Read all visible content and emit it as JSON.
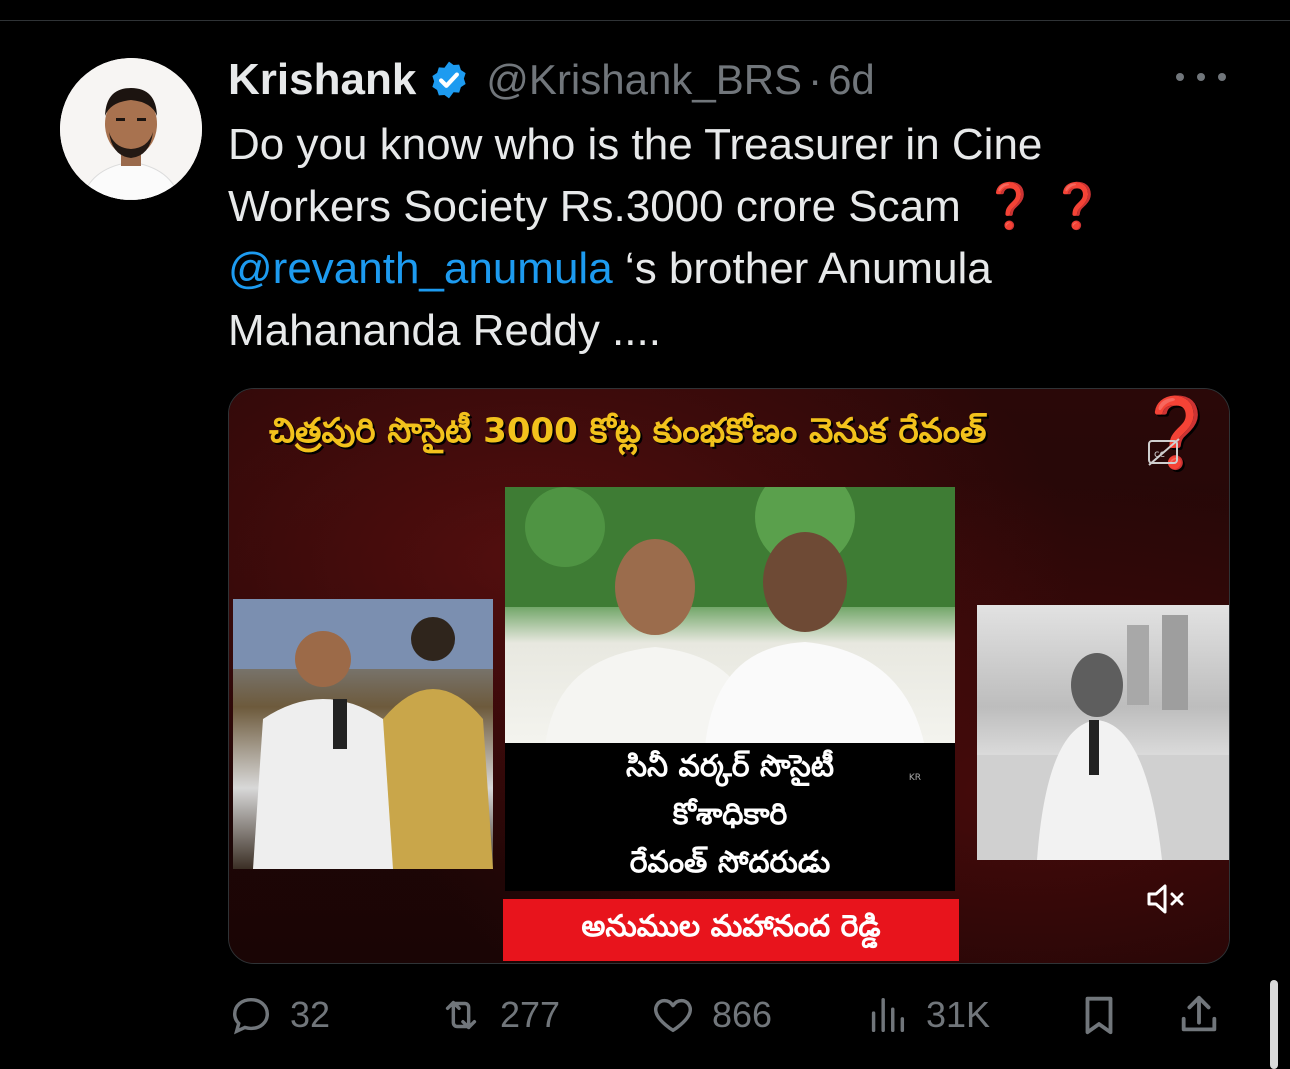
{
  "tweet": {
    "author_name": "Krishank",
    "handle": "@Krishank_BRS",
    "separator": "·",
    "time": "6d",
    "text_lines": [
      "Do you know who is the Treasurer in Cine",
      "Workers Society Rs.3000 crore Scam"
    ],
    "mention": "@revanth_anumula",
    "mention_suffix": " ‘s brother Anumula",
    "last_line": "Mahananda Reddy ....",
    "emoji": "❓ ❓"
  },
  "media": {
    "headline": "చిత్రపురి సొసైటీ 3000 కోట్ల కుంభకోణం వెనుక రేవంత్",
    "headline_mark": "❓",
    "caption_lines": [
      "సినీ వర్కర్ సొసైటీ",
      "కోశాధికారి",
      "రేవంత్ సోదరుడు"
    ],
    "caption_mark": "KR",
    "banner": "అనుముల మహానంద రెడ్డి",
    "icons": [
      "closed-caption-icon",
      "mute-icon"
    ]
  },
  "actions": {
    "replies": "32",
    "reposts": "277",
    "likes": "866",
    "views": "31K"
  },
  "colors": {
    "background": "#000000",
    "text": "#e7e9ea",
    "muted": "#71767b",
    "link": "#1d9bf0",
    "verified": "#1d9bf0",
    "banner_red": "#e8141c",
    "headline_yellow": "#f2c21c"
  }
}
